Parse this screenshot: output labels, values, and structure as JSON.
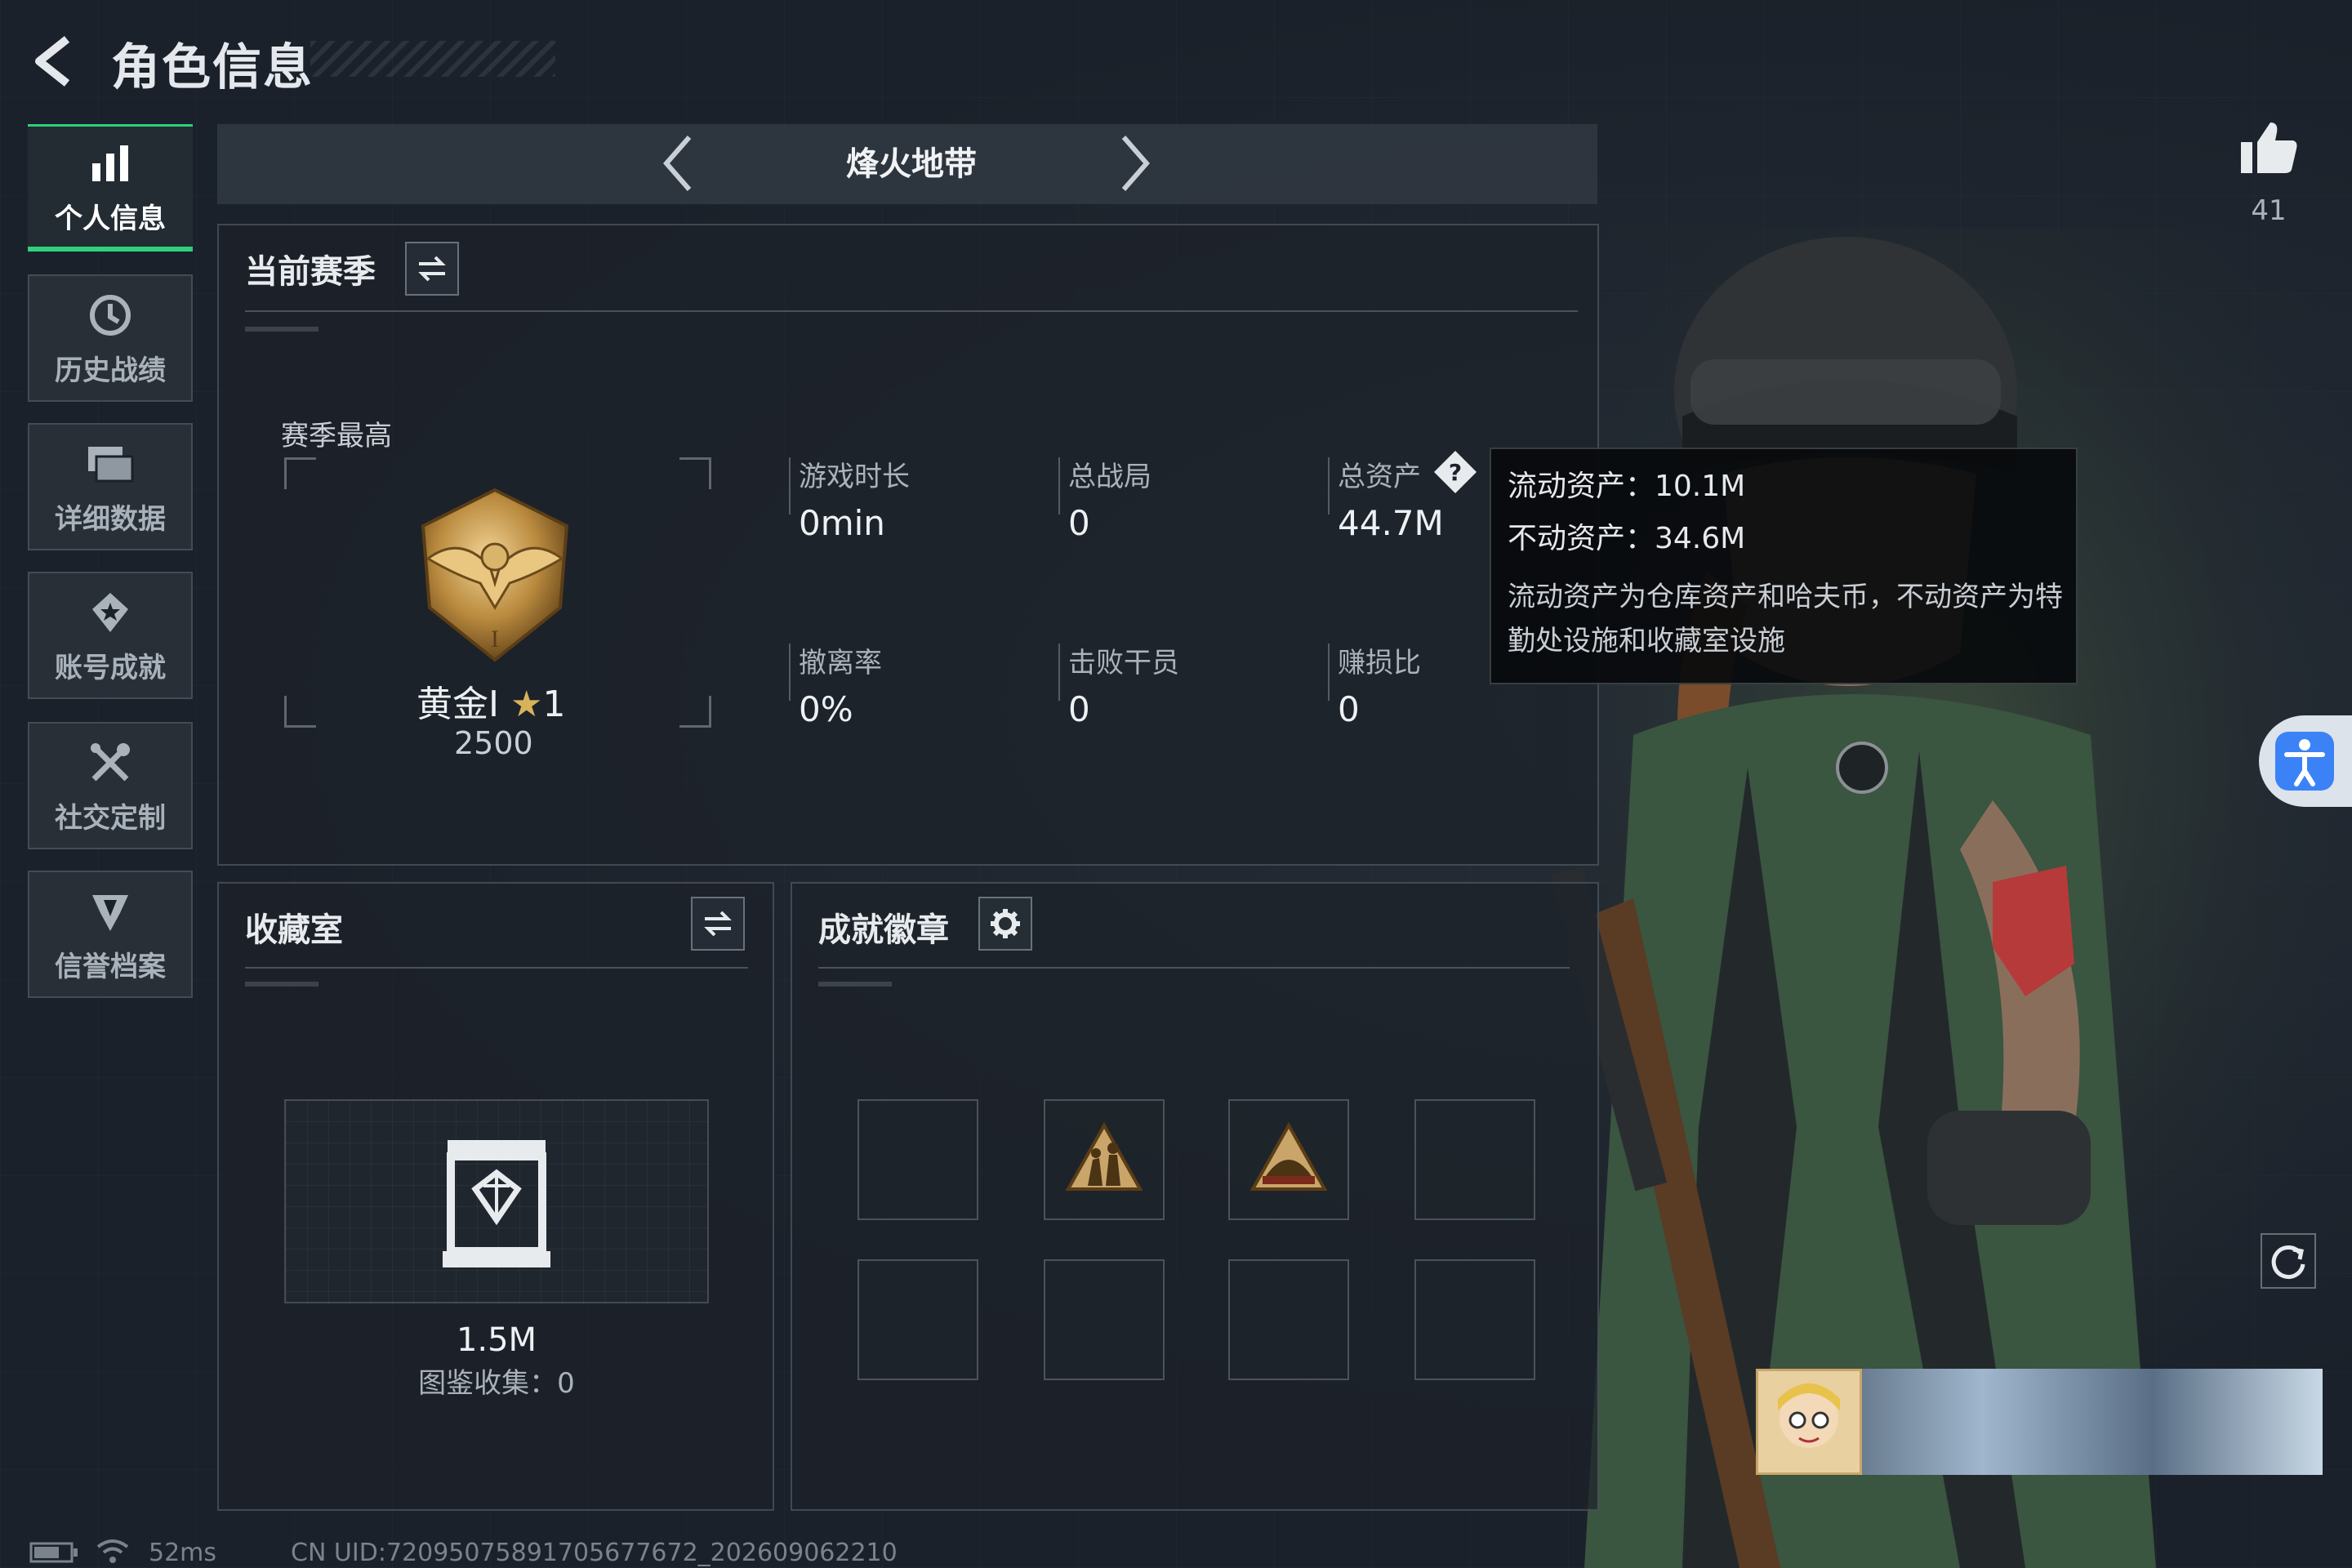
{
  "header": {
    "title": "角色信息"
  },
  "sidebar": {
    "items": [
      {
        "label": "个人信息",
        "icon": "bar-chart-icon"
      },
      {
        "label": "历史战绩",
        "icon": "history-clock-icon"
      },
      {
        "label": "详细数据",
        "icon": "folder-icon"
      },
      {
        "label": "账号成就",
        "icon": "achievement-icon"
      },
      {
        "label": "社交定制",
        "icon": "wrench-cross-icon"
      },
      {
        "label": "信誉档案",
        "icon": "credibility-icon"
      }
    ]
  },
  "mode_selector": {
    "title": "烽火地带"
  },
  "likes": {
    "count": "41"
  },
  "season": {
    "title": "当前赛季",
    "best_label": "赛季最高",
    "rank_name": "黄金Ⅰ",
    "rank_stars": "1",
    "rank_score": "2500",
    "stats": [
      {
        "label": "游戏时长",
        "value": "0min"
      },
      {
        "label": "总战局",
        "value": "0"
      },
      {
        "label": "总资产",
        "value": "44.7M"
      },
      {
        "label": "撤离率",
        "value": "0%"
      },
      {
        "label": "击败干员",
        "value": "0"
      },
      {
        "label": "赚损比",
        "value": "0"
      }
    ]
  },
  "tooltip": {
    "liquid": "流动资产：10.1M",
    "fixed": "不动资产：34.6M",
    "description": "流动资产为仓库资产和哈夫币，不动资产为特勤处设施和收藏室设施"
  },
  "collection": {
    "title": "收藏室",
    "value": "1.5M",
    "catalog": "图鉴收集：0"
  },
  "badges": {
    "title": "成就徽章",
    "slots": [
      "empty",
      "badge-soldiers",
      "badge-dome",
      "empty",
      "empty",
      "empty",
      "empty",
      "empty"
    ]
  },
  "status_bar": {
    "ping": "52ms",
    "uid": "CN UID:7209507589170567767​2_202609062210"
  },
  "colors": {
    "accent": "#2fd07a",
    "accessibility": "#3b82f6"
  }
}
